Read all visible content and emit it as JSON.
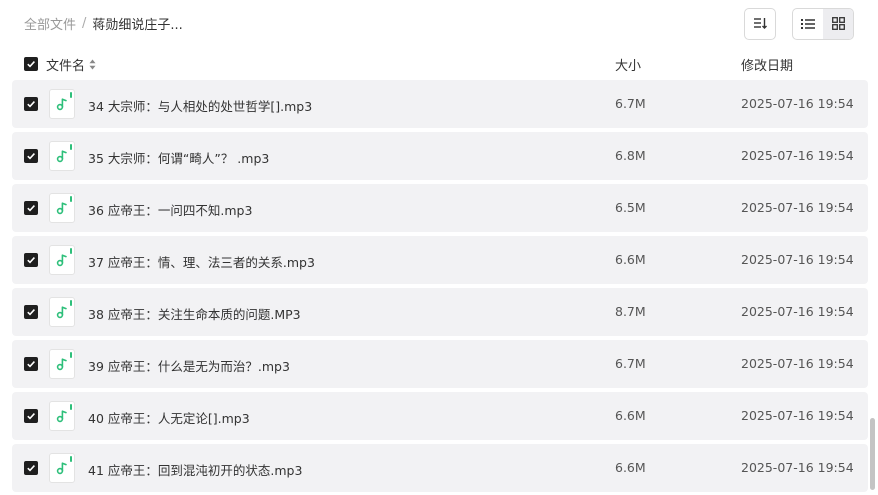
{
  "breadcrumb": {
    "root": "全部文件",
    "separator": "/",
    "current": "蒋勋细说庄子..."
  },
  "toolbar": {
    "sort_icon": "sort-icon",
    "list_view_icon": "list-view-icon",
    "grid_view_icon": "grid-view-icon"
  },
  "columns": {
    "name": "文件名",
    "size": "大小",
    "modified": "修改日期"
  },
  "colors": {
    "accent": "#2dbf7a",
    "checkbox": "#1f1f1f",
    "row_bg": "#f2f2f4"
  },
  "files": [
    {
      "name": "34 大宗师：与人相处的处世哲学[].mp3",
      "size": "6.7M",
      "date": "2025-07-16 19:54",
      "icon": "audio-file-icon",
      "checked": true
    },
    {
      "name": "35 大宗师：何谓“畸人”？ .mp3",
      "size": "6.8M",
      "date": "2025-07-16 19:54",
      "icon": "audio-file-icon",
      "checked": true
    },
    {
      "name": "36 应帝王：一问四不知.mp3",
      "size": "6.5M",
      "date": "2025-07-16 19:54",
      "icon": "audio-file-icon",
      "checked": true
    },
    {
      "name": "37 应帝王：情、理、法三者的关系.mp3",
      "size": "6.6M",
      "date": "2025-07-16 19:54",
      "icon": "audio-file-icon",
      "checked": true
    },
    {
      "name": "38 应帝王：关注生命本质的问题.MP3",
      "size": "8.7M",
      "date": "2025-07-16 19:54",
      "icon": "audio-file-icon",
      "checked": true
    },
    {
      "name": "39 应帝王：什么是无为而治？.mp3",
      "size": "6.7M",
      "date": "2025-07-16 19:54",
      "icon": "audio-file-icon",
      "checked": true
    },
    {
      "name": "40 应帝王：人无定论[].mp3",
      "size": "6.6M",
      "date": "2025-07-16 19:54",
      "icon": "audio-file-icon",
      "checked": true
    },
    {
      "name": "41 应帝王：回到混沌初开的状态.mp3",
      "size": "6.6M",
      "date": "2025-07-16 19:54",
      "icon": "audio-file-icon",
      "checked": true
    }
  ]
}
